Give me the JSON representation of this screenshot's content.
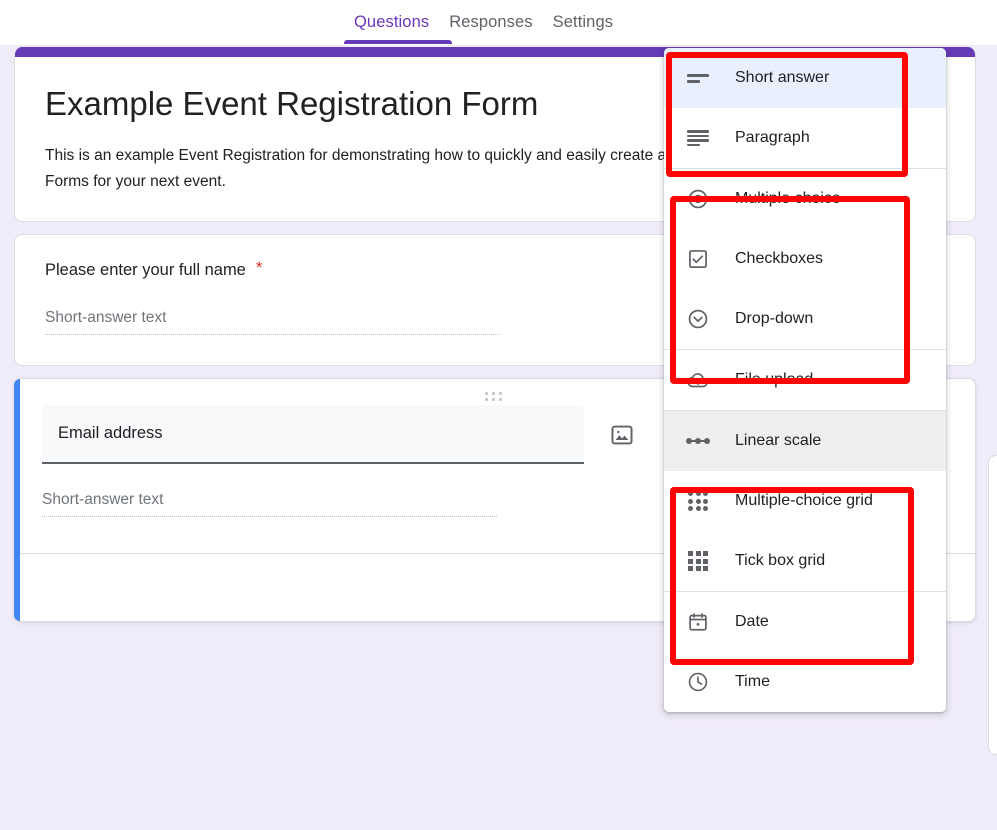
{
  "topbar": {
    "tabs": [
      {
        "label": "Questions",
        "active": true
      },
      {
        "label": "Responses",
        "active": false
      },
      {
        "label": "Settings",
        "active": false
      }
    ]
  },
  "form": {
    "title": "Example Event Registration Form",
    "description": "This is an example Event Registration for demonstrating how to quickly and easily create an Event Registration Form with Google Forms for your next event.",
    "accent_color": "#673ab7",
    "questions": [
      {
        "title": "Please enter your full name",
        "required": true,
        "required_marker": "*",
        "answer_hint": "Short-answer text"
      },
      {
        "title": "Email address",
        "active": true,
        "answer_hint": "Short-answer text",
        "active_border_color": "#4285f4",
        "image_icon": "image-icon",
        "duplicate_icon": "duplicate-icon",
        "drag_handle": "drag-handle-dots"
      }
    ]
  },
  "question_type_menu": {
    "groups": [
      {
        "highlighted": true,
        "items": [
          {
            "label": "Short answer",
            "icon": "short-answer-icon",
            "state": "selected"
          },
          {
            "label": "Paragraph",
            "icon": "paragraph-icon",
            "state": "normal"
          }
        ]
      },
      {
        "highlighted": true,
        "items": [
          {
            "label": "Multiple choice",
            "icon": "radio-button-icon",
            "state": "normal"
          },
          {
            "label": "Checkboxes",
            "icon": "checkbox-icon",
            "state": "normal"
          },
          {
            "label": "Drop-down",
            "icon": "chevron-down-circle-icon",
            "state": "normal"
          }
        ]
      },
      {
        "highlighted": false,
        "items": [
          {
            "label": "File upload",
            "icon": "cloud-upload-icon",
            "state": "normal"
          }
        ]
      },
      {
        "highlighted": true,
        "items": [
          {
            "label": "Linear scale",
            "icon": "linear-scale-icon",
            "state": "hover"
          },
          {
            "label": "Multiple-choice grid",
            "icon": "multiple-choice-grid-icon",
            "state": "normal"
          },
          {
            "label": "Tick box grid",
            "icon": "tick-box-grid-icon",
            "state": "normal"
          }
        ]
      },
      {
        "highlighted": false,
        "items": [
          {
            "label": "Date",
            "icon": "calendar-icon",
            "state": "normal"
          },
          {
            "label": "Time",
            "icon": "clock-icon",
            "state": "normal"
          }
        ]
      }
    ],
    "annotation_color": "#fb0505"
  }
}
